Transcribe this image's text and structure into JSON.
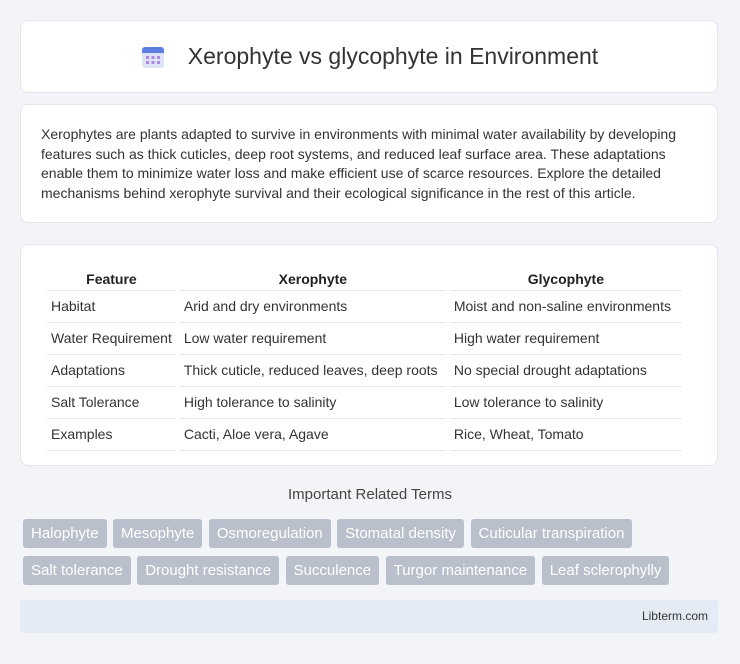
{
  "header": {
    "title": "Xerophyte vs glycophyte in Environment",
    "icon": "calendar-icon"
  },
  "intro": {
    "text": "Xerophytes are plants adapted to survive in environments with minimal water availability by developing features such as thick cuticles, deep root systems, and reduced leaf surface area. These adaptations enable them to minimize water loss and make efficient use of scarce resources. Explore the detailed mechanisms behind xerophyte survival and their ecological significance in the rest of this article."
  },
  "table": {
    "headers": [
      "Feature",
      "Xerophyte",
      "Glycophyte"
    ],
    "rows": [
      [
        "Habitat",
        "Arid and dry environments",
        "Moist and non-saline environments"
      ],
      [
        "Water Requirement",
        "Low water requirement",
        "High water requirement"
      ],
      [
        "Adaptations",
        "Thick cuticle, reduced leaves, deep roots",
        "No special drought adaptations"
      ],
      [
        "Salt Tolerance",
        "High tolerance to salinity",
        "Low tolerance to salinity"
      ],
      [
        "Examples",
        "Cacti, Aloe vera, Agave",
        "Rice, Wheat, Tomato"
      ]
    ]
  },
  "related": {
    "title": "Important Related Terms",
    "tags": [
      "Halophyte",
      "Mesophyte",
      "Osmoregulation",
      "Stomatal density",
      "Cuticular transpiration",
      "Salt tolerance",
      "Drought resistance",
      "Succulence",
      "Turgor maintenance",
      "Leaf sclerophylly"
    ]
  },
  "footer": {
    "brand": "Libterm.com"
  }
}
